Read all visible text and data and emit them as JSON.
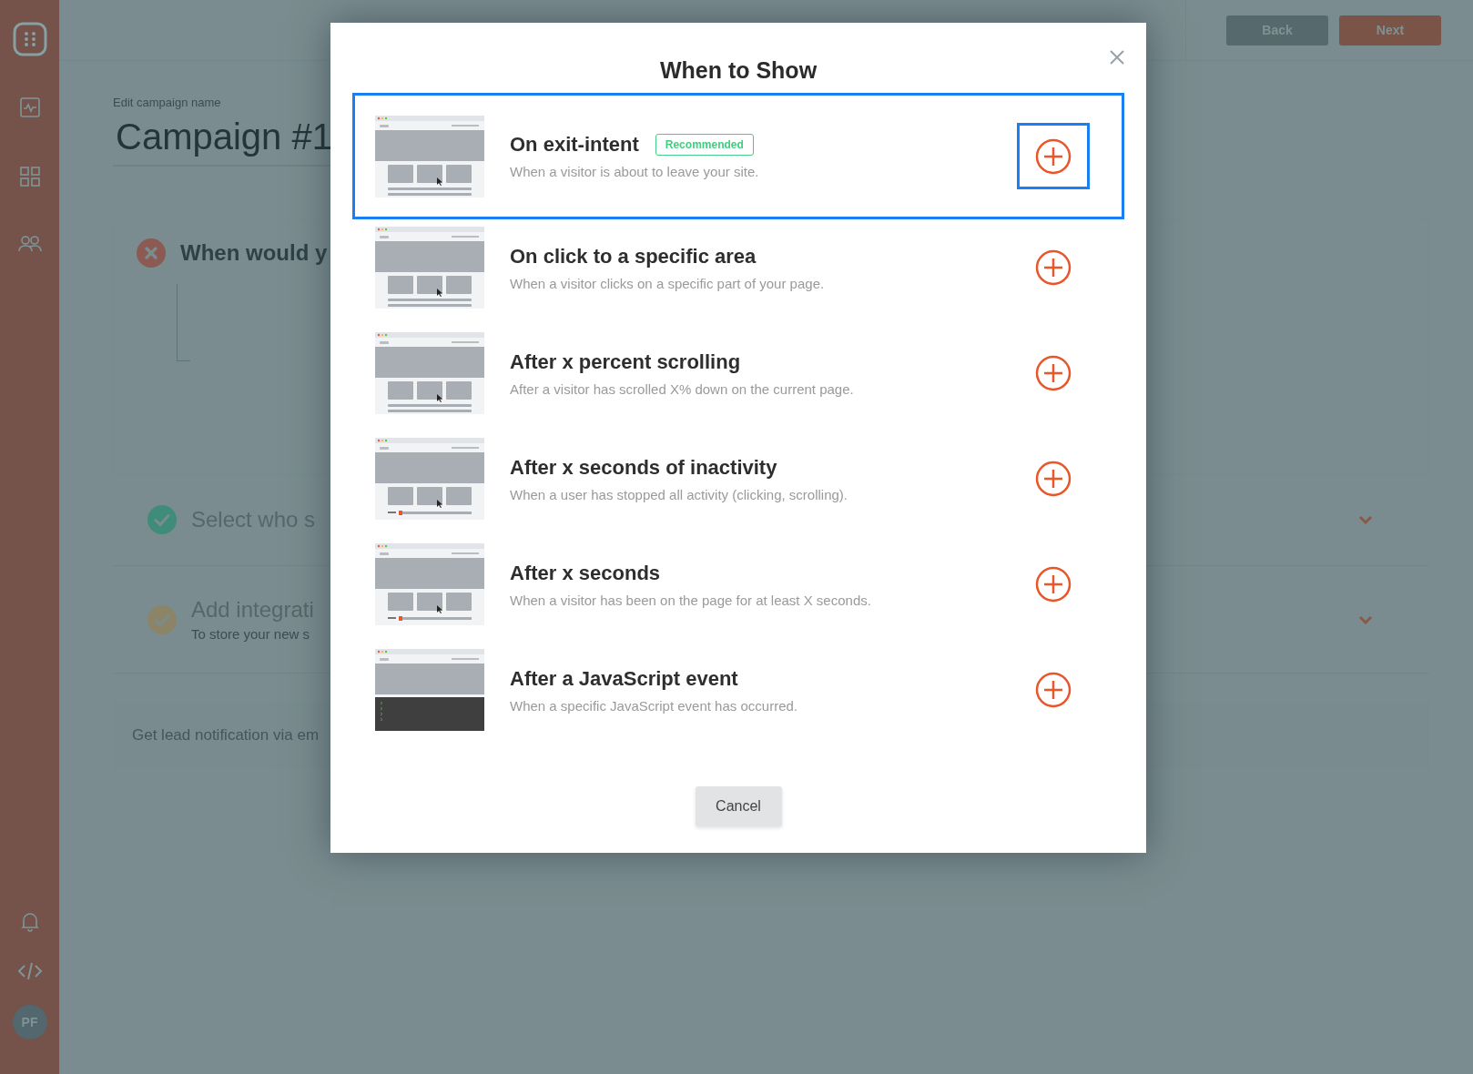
{
  "sidebar": {
    "avatar": "PF"
  },
  "header": {
    "buttons": [
      {
        "label": "Back",
        "kind": "secondary"
      },
      {
        "label": "Next",
        "kind": "primary"
      }
    ]
  },
  "campaign": {
    "name_label": "Edit campaign name",
    "name": "Campaign #1"
  },
  "steps": [
    {
      "title": "When would y",
      "kind": "error",
      "expanded": true
    },
    {
      "title": "Select who s",
      "kind": "done",
      "expanded": false
    },
    {
      "title": "Add integrati",
      "subtitle": "To store your new s",
      "kind": "pending",
      "expanded": false
    }
  ],
  "notification_field": {
    "placeholder": "Get lead notification via em"
  },
  "modal": {
    "title": "When to Show",
    "options": [
      {
        "title": "On exit-intent",
        "badge": "Recommended",
        "description": "When a visitor is about to leave your site.",
        "kind": "cursor",
        "selected": true
      },
      {
        "title": "On click to a specific area",
        "description": "When a visitor clicks on a specific part of your page.",
        "kind": "cursor",
        "selected": false
      },
      {
        "title": "After x percent scrolling",
        "description": "After a visitor has scrolled X% down on the current page.",
        "kind": "cursor",
        "selected": false
      },
      {
        "title": "After x seconds of inactivity",
        "description": "When a user has stopped all activity (clicking, scrolling).",
        "kind": "timer",
        "selected": false
      },
      {
        "title": "After x seconds",
        "description": "When a visitor has been on the page for at least X seconds.",
        "kind": "timer",
        "selected": false
      },
      {
        "title": "After a JavaScript event",
        "description": "When a specific JavaScript event has occurred.",
        "kind": "console",
        "selected": false
      }
    ],
    "cancel": "Cancel"
  }
}
